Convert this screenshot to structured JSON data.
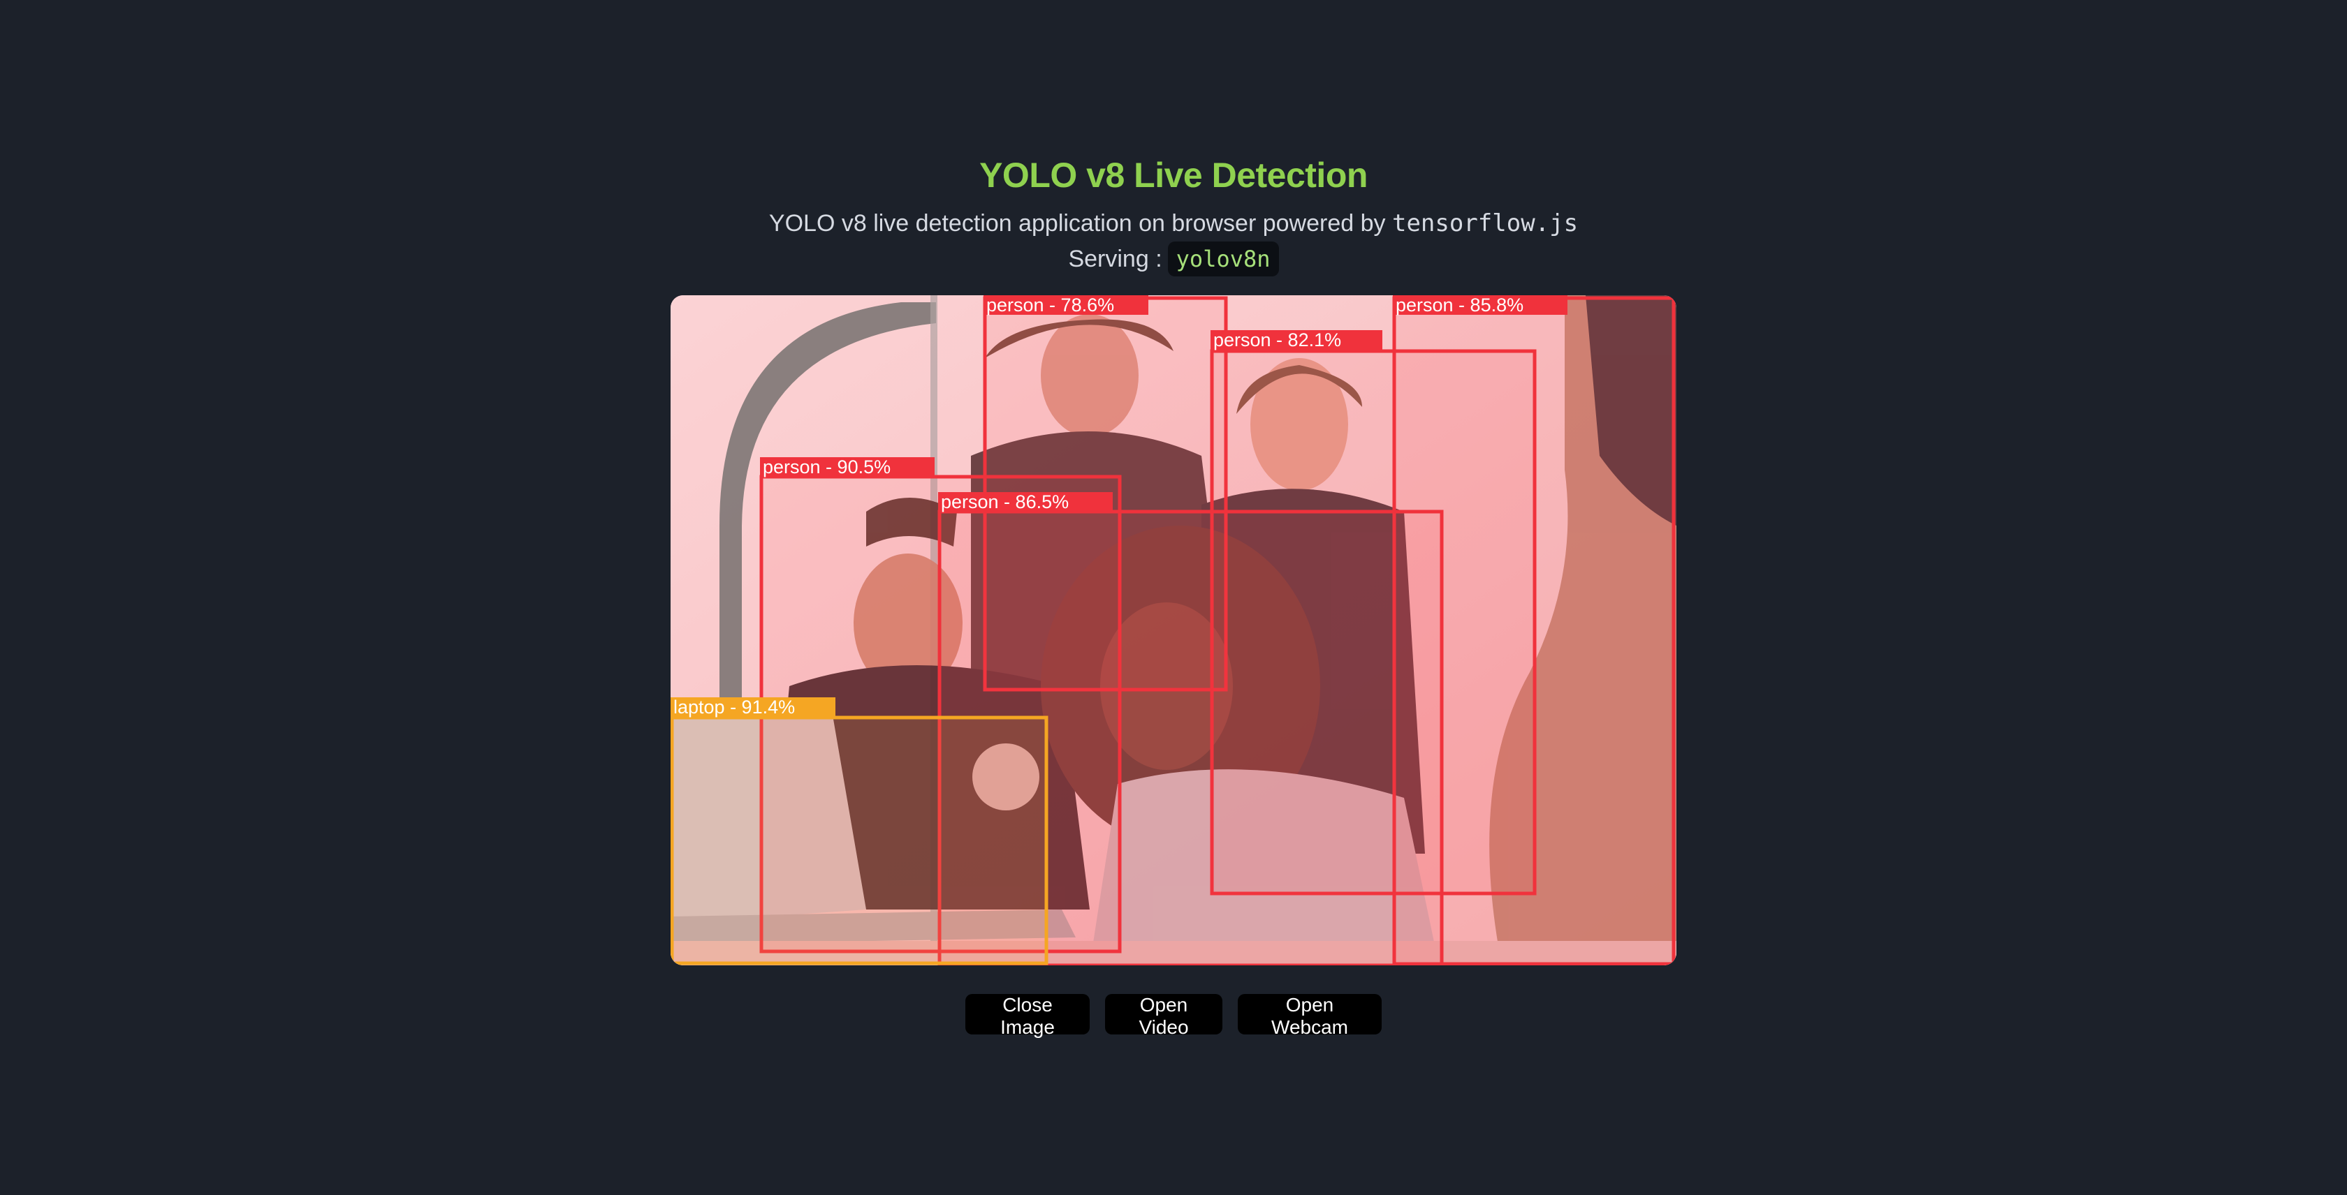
{
  "header": {
    "title": "YOLO v8 Live Detection",
    "subtitle_prefix": "YOLO v8 live detection application on browser powered by",
    "subtitle_code": "tensorflow.js",
    "serving_label": "Serving :",
    "model": "yolov8n"
  },
  "controls": {
    "close_image": "Close Image",
    "open_video": "Open Video",
    "open_webcam": "Open Webcam"
  },
  "colors": {
    "title": "#8fd14f",
    "background": "#1c212a",
    "person_box": "#f0323c",
    "laptop_box": "#f5a623"
  },
  "detections": [
    {
      "label": "person - 78.6%",
      "class": "person"
    },
    {
      "label": "person - 85.8%",
      "class": "person"
    },
    {
      "label": "person - 82.1%",
      "class": "person"
    },
    {
      "label": "person - 90.5%",
      "class": "person"
    },
    {
      "label": "person - 86.5%",
      "class": "person"
    },
    {
      "label": "laptop - 91.4%",
      "class": "laptop"
    }
  ]
}
